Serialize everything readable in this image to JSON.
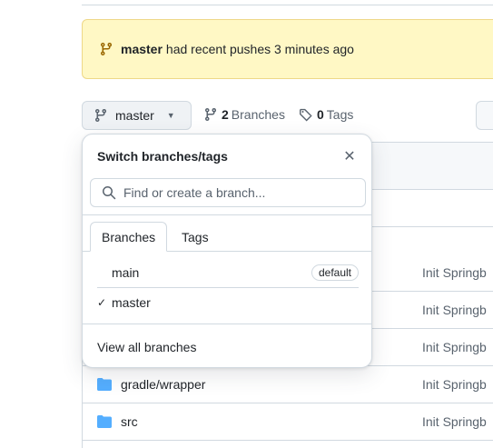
{
  "banner": {
    "branch": "master",
    "message": "had recent pushes 3 minutes ago"
  },
  "branch_button": {
    "label": "master"
  },
  "meta": {
    "branches_count": "2",
    "branches_label": "Branches",
    "tags_count": "0",
    "tags_label": "Tags"
  },
  "files": [
    {
      "name": "gradle/wrapper",
      "message": "Init Springb"
    },
    {
      "name": "src",
      "message": "Init Springb"
    }
  ],
  "behind_messages": [
    "Init Springb",
    "Init Springb",
    "Init Springb"
  ],
  "dropdown": {
    "title": "Switch branches/tags",
    "search_placeholder": "Find or create a branch...",
    "tabs": [
      "Branches",
      "Tags"
    ],
    "branches": [
      {
        "name": "main",
        "badge": "default",
        "checked": ""
      },
      {
        "name": "master",
        "badge": "",
        "checked": "✓"
      }
    ],
    "view_all": "View all branches"
  },
  "colors": {
    "banner_bg": "#fff8c5",
    "folder": "#54aeff",
    "accent": "#0969da"
  }
}
